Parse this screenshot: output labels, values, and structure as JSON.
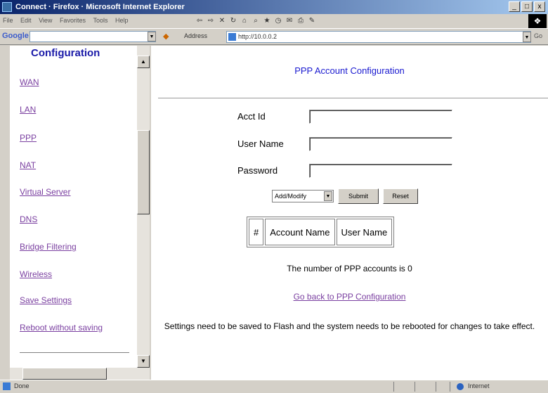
{
  "window": {
    "title": "Connect · Firefox · Microsoft Internet Explorer",
    "controls": [
      "_",
      "□",
      "x"
    ]
  },
  "menu": [
    "File",
    "Edit",
    "View",
    "Favorites",
    "Tools",
    "Help"
  ],
  "google": {
    "logo": "Google"
  },
  "address": {
    "label": "Address",
    "value": "http://10.0.0.2"
  },
  "left_nav": {
    "heading": "Configuration",
    "items": [
      "WAN",
      "LAN",
      "PPP",
      "NAT",
      "Virtual Server",
      "DNS",
      "Bridge Filtering",
      "Wireless",
      "Save Settings",
      "Reboot without saving"
    ]
  },
  "main": {
    "title": "PPP Account Configuration",
    "fields": {
      "acct_id": "Acct Id",
      "user_name": "User Name",
      "password": "Password"
    },
    "action_select": "Add/Modify",
    "submit": "Submit",
    "reset": "Reset",
    "table_headers": [
      "#",
      "Account Name",
      "User Name"
    ],
    "count_text": "The number of PPP accounts is 0",
    "back_link": "Go back to PPP Configuration",
    "note": "Settings need to be saved to Flash and the system needs to be rebooted for changes to take effect."
  },
  "status": {
    "text": "Done",
    "zone": "Internet"
  }
}
